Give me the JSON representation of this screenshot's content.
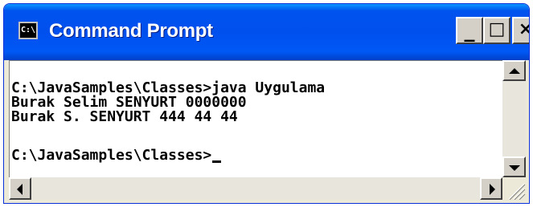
{
  "window": {
    "title": "Command Prompt",
    "icon": "command-prompt-icon",
    "icon_text": "C:\\"
  },
  "controls": {
    "minimize_icon": "minimize-icon",
    "maximize_icon": "maximize-icon",
    "close_icon": "close-icon",
    "minimize_glyph": "_",
    "maximize_glyph": "□",
    "close_glyph": "×"
  },
  "console": {
    "lines": [
      "C:\\JavaSamples\\Classes>java Uygulama",
      "Burak Selim SENYURT 0000000",
      "Burak S. SENYURT 444 44 44",
      "",
      "C:\\JavaSamples\\Classes>"
    ]
  },
  "colors": {
    "titlebar": "#0054e3",
    "console_background": "#ffffff",
    "console_text": "#000000"
  }
}
